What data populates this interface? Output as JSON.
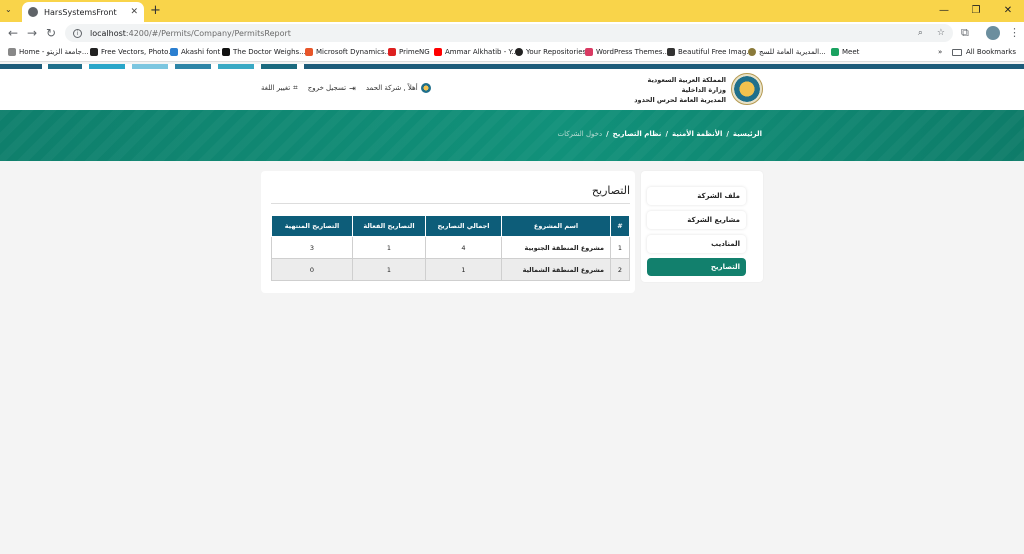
{
  "browser": {
    "tab_title": "HarsSystemsFront",
    "url_host": "localhost",
    "url_path": ":4200/#/Permits/Company/PermitsReport",
    "bookmarks": [
      "Home - جامعة الزيتو...",
      "Free Vectors, Photo...",
      "Akashi font",
      "The Doctor Weighs...",
      "Microsoft Dynamics...",
      "PrimeNG",
      "Ammar Alkhatib - Y...",
      "Your Repositories",
      "WordPress Themes...",
      "Beautiful Free Imag...",
      "المديرية العامة للسج...",
      "Meet"
    ],
    "all_bookmarks": "All Bookmarks"
  },
  "header": {
    "gov_line1": "المملكة العربية السعودية",
    "gov_line2": "وزارة الداخلية",
    "gov_line3": "المديرية العامة لحرس الحدود",
    "greeting": "أهلاً , شركة الحمد",
    "logout": "تسجيل خروج",
    "change_language": "تغيير اللغة"
  },
  "breadcrumb": {
    "home": "الرئيسية",
    "security_systems": "الأنظمة الأمنية",
    "permits_system": "نظام التصاريح",
    "current": "دخول الشركات",
    "separator": "/"
  },
  "sidebar": {
    "items": [
      {
        "label": "ملف الشركة"
      },
      {
        "label": "مشاريع الشركة"
      },
      {
        "label": "المناديب"
      },
      {
        "label": "التصاريح"
      }
    ]
  },
  "main": {
    "title": "التصاريح",
    "table": {
      "headers": [
        "#",
        "اسم المشروع",
        "اجمالي التصاريح",
        "التصاريح الفعالة",
        "التصاريح المنتهية"
      ],
      "rows": [
        [
          "1",
          "مشروع المنطقة الجنوبية",
          "4",
          "1",
          "3"
        ],
        [
          "2",
          "مشروع المنطقة الشمالية",
          "1",
          "1",
          "0"
        ]
      ]
    }
  },
  "colors": {
    "primary_green": "#12806d",
    "table_header": "#0d5d79",
    "browser_frame": "#f9d44a"
  }
}
